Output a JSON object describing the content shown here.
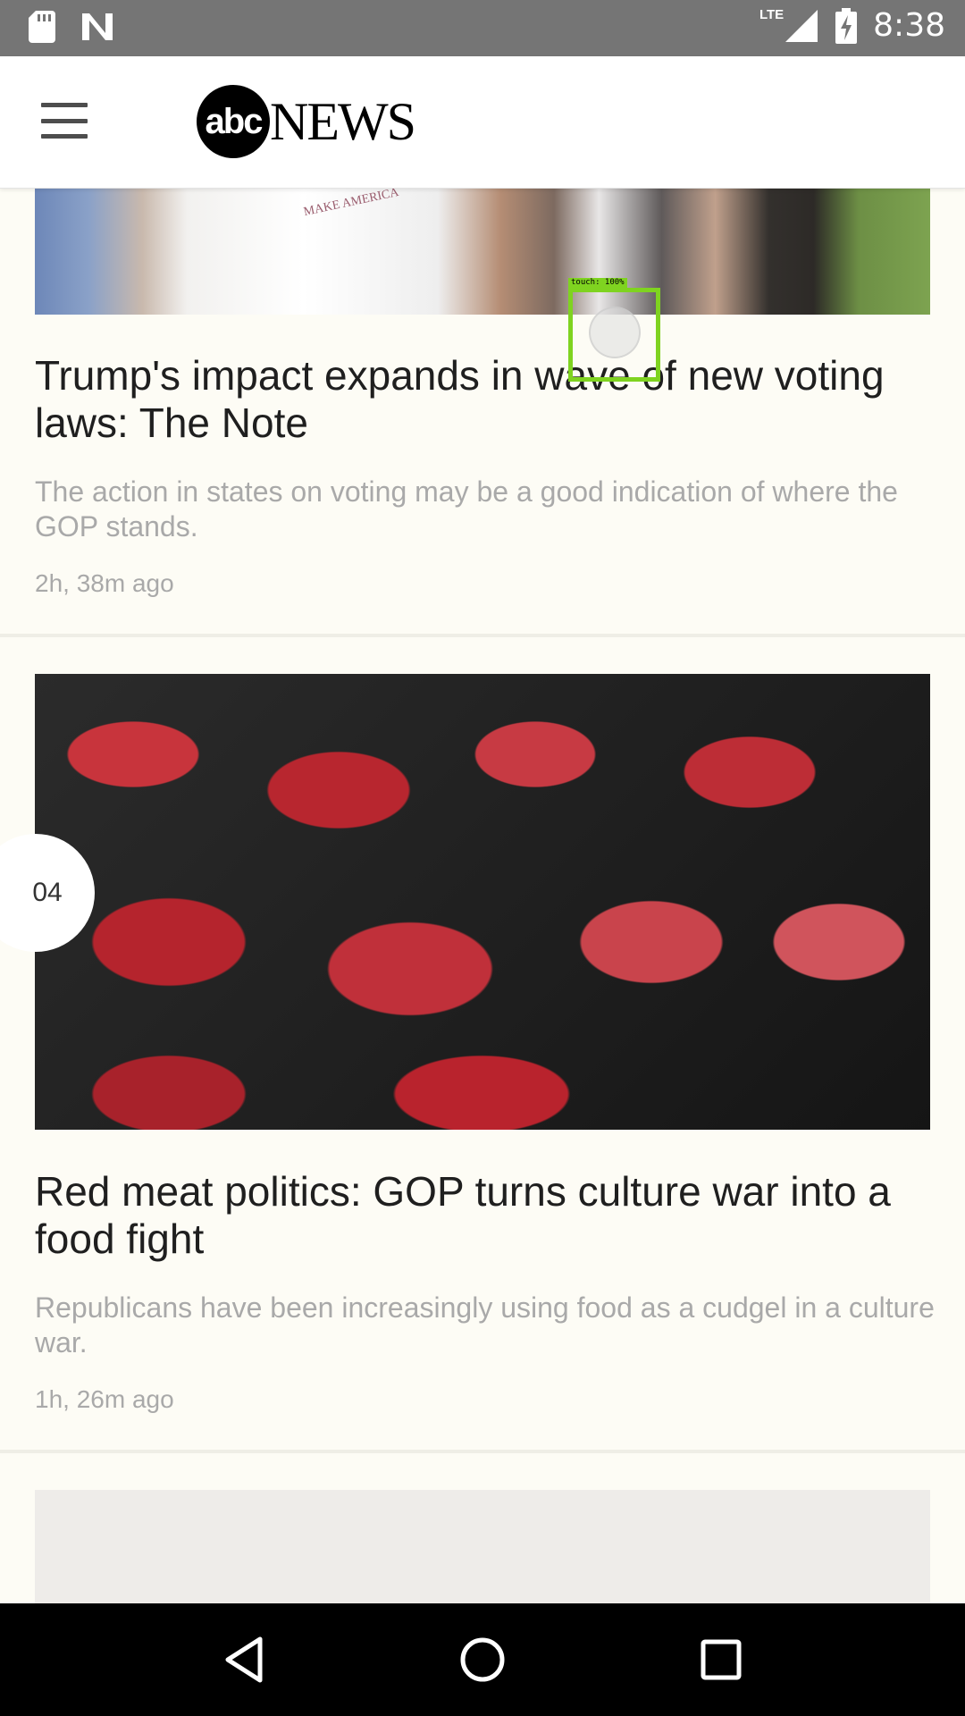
{
  "status_bar": {
    "time": "8:38",
    "network": "LTE",
    "icons": [
      "sd-card-icon",
      "n-notification-icon",
      "signal-icon",
      "battery-charging-icon"
    ]
  },
  "header": {
    "logo_abc": "abc",
    "logo_news": "NEWS"
  },
  "articles": [
    {
      "headline": "Trump's impact expands in wave of new voting laws: The Note",
      "summary": "The action in states on voting may be a good indication of where the GOP stands.",
      "timestamp": "2h, 38m ago"
    },
    {
      "rank": "04",
      "headline": "Red meat politics: GOP turns culture war into a food fight",
      "summary": "Republicans have been increasingly using food as a cudgel in a culture war.",
      "timestamp": "1h, 26m ago"
    }
  ],
  "touch_overlay": {
    "label": "touch: 100%"
  },
  "nav_bar": {
    "icons": [
      "back-icon",
      "home-icon",
      "recents-icon"
    ]
  }
}
